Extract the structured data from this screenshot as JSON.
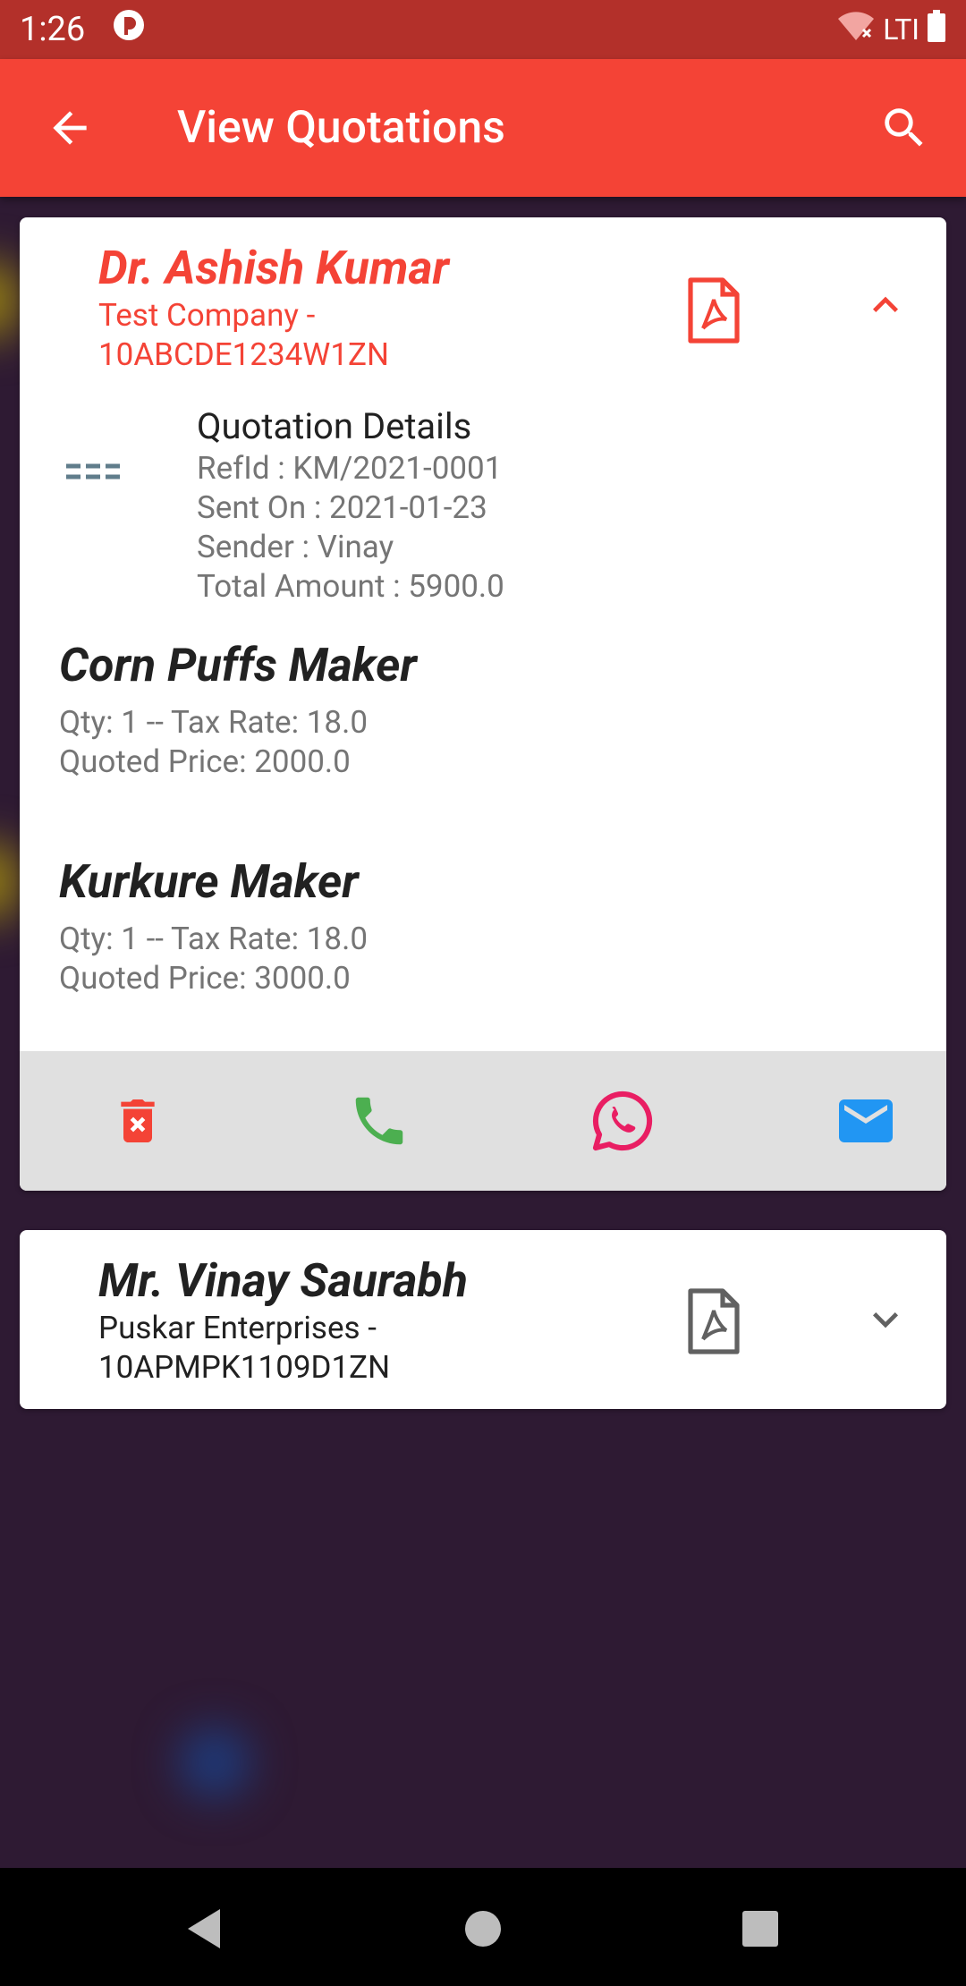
{
  "status_bar": {
    "time": "1:26",
    "network": "LTI"
  },
  "app_bar": {
    "title": "View Quotations"
  },
  "quotations": [
    {
      "name": "Dr. Ashish Kumar",
      "company": "Test Company - 10ABCDE1234W1ZN",
      "expanded": true,
      "details": {
        "title": "Quotation Details",
        "ref": "RefId : KM/2021-0001",
        "sent_on": "Sent On : 2021-01-23",
        "sender": "Sender : Vinay",
        "total": "Total Amount : 5900.0"
      },
      "items": [
        {
          "name": "Corn Puffs Maker",
          "qty_tax": "Qty: 1 -- Tax Rate: 18.0",
          "price": "Quoted Price: 2000.0"
        },
        {
          "name": "Kurkure Maker",
          "qty_tax": "Qty: 1 -- Tax Rate: 18.0",
          "price": "Quoted Price: 3000.0"
        }
      ]
    },
    {
      "name": "Mr. Vinay Saurabh",
      "company": "Puskar Enterprises - 10APMPK1109D1ZN",
      "expanded": false
    }
  ],
  "colors": {
    "primary": "#f44336",
    "status_bar": "#b3302a",
    "background": "#2e1a33",
    "delete": "#f44336",
    "call": "#4caf50",
    "whatsapp": "#e91e63",
    "email": "#2196f3",
    "muted_icon": "#616161"
  },
  "icons": {
    "back": "arrow-left-icon",
    "search": "search-icon",
    "pdf": "pdf-file-icon",
    "expand": "chevron-icon",
    "details": "dashed-lines-icon",
    "delete": "trash-icon",
    "call": "phone-icon",
    "whatsapp": "whatsapp-icon",
    "email": "mail-icon"
  }
}
